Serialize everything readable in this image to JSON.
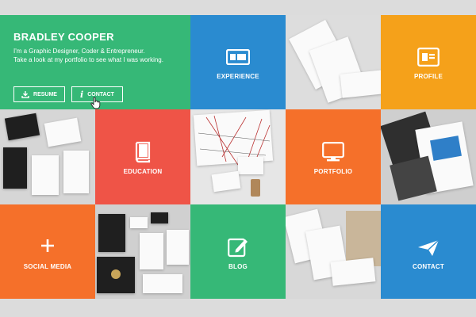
{
  "hero": {
    "name": "BRADLEY COOPER",
    "tagline_1": "I'm a Graphic Designer, Coder & Entrepreneur.",
    "tagline_2": "Take a look at my portfolio to see what I was working.",
    "resume_label": "RESUME",
    "contact_label": "CONTACT"
  },
  "tiles": {
    "experience": "EXPERIENCE",
    "profile": "PROFILE",
    "education": "EDUCATION",
    "portfolio": "PORTFOLIO",
    "social_media": "SOCIAL MEDIA",
    "blog": "BLOG",
    "contact": "CONTACT"
  },
  "colors": {
    "green": "#36b877",
    "blue": "#2a8bd0",
    "orange_yellow": "#f5a11a",
    "red": "#ef5447",
    "orange": "#f5702a"
  },
  "icons": {
    "experience": "id-card-icon",
    "profile": "profile-card-icon",
    "education": "book-icon",
    "portfolio": "monitor-icon",
    "social_media": "plus-icon",
    "blog": "edit-icon",
    "contact": "paper-plane-icon"
  }
}
